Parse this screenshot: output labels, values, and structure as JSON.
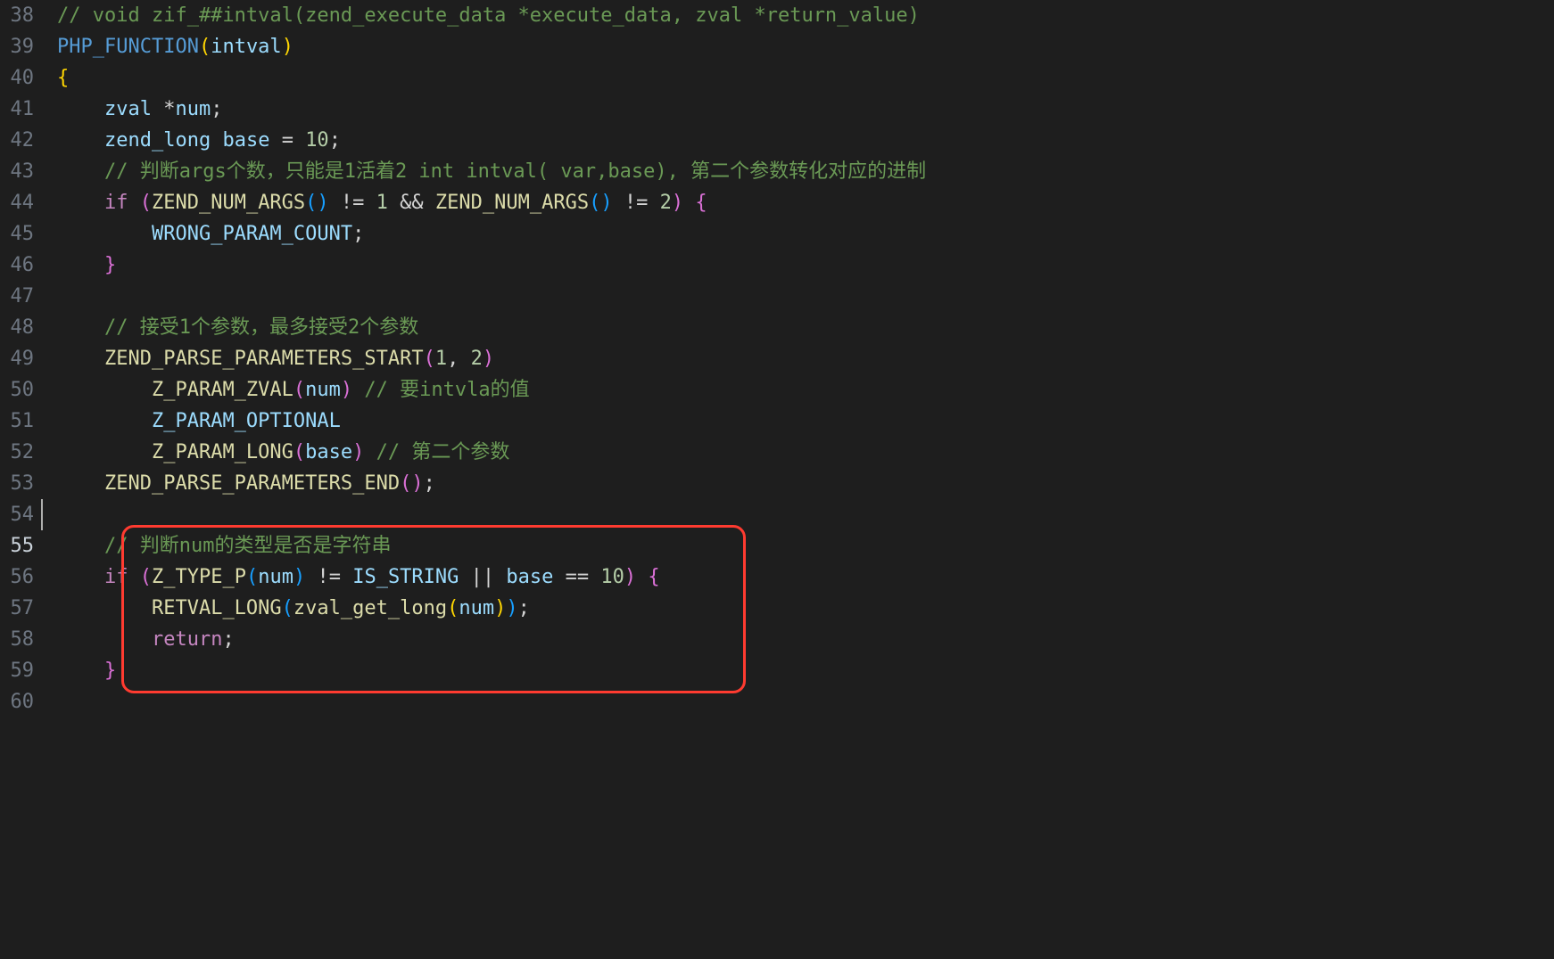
{
  "editor": {
    "startLine": 38,
    "activeLine": 55,
    "lines": [
      {
        "n": 38,
        "segments": [
          {
            "cls": "tok-comment",
            "t": "// void zif_##intval(zend_execute_data *execute_data, zval *return_value)"
          }
        ]
      },
      {
        "n": 39,
        "segments": [
          {
            "cls": "tok-fn",
            "t": "PHP_FUNCTION"
          },
          {
            "cls": "tok-brace-y",
            "t": "("
          },
          {
            "cls": "tok-ident",
            "t": "intval"
          },
          {
            "cls": "tok-brace-y",
            "t": ")"
          }
        ]
      },
      {
        "n": 40,
        "segments": [
          {
            "cls": "tok-brace-y",
            "t": "{"
          }
        ]
      },
      {
        "n": 41,
        "segments": [
          {
            "cls": "",
            "t": "    "
          },
          {
            "cls": "tok-ident",
            "t": "zval"
          },
          {
            "cls": "",
            "t": " "
          },
          {
            "cls": "tok-op",
            "t": "*"
          },
          {
            "cls": "tok-ident",
            "t": "num"
          },
          {
            "cls": "tok-op",
            "t": ";"
          }
        ]
      },
      {
        "n": 42,
        "segments": [
          {
            "cls": "",
            "t": "    "
          },
          {
            "cls": "tok-ident",
            "t": "zend_long"
          },
          {
            "cls": "",
            "t": " "
          },
          {
            "cls": "tok-ident",
            "t": "base"
          },
          {
            "cls": "",
            "t": " "
          },
          {
            "cls": "tok-op",
            "t": "="
          },
          {
            "cls": "",
            "t": " "
          },
          {
            "cls": "tok-number",
            "t": "10"
          },
          {
            "cls": "tok-op",
            "t": ";"
          }
        ]
      },
      {
        "n": 43,
        "segments": [
          {
            "cls": "",
            "t": "    "
          },
          {
            "cls": "tok-comment",
            "t": "// 判断args个数，只能是1活着2 int intval( var,base), 第二个参数转化对应的进制"
          }
        ]
      },
      {
        "n": 44,
        "segments": [
          {
            "cls": "",
            "t": "    "
          },
          {
            "cls": "tok-keyword",
            "t": "if"
          },
          {
            "cls": "",
            "t": " "
          },
          {
            "cls": "tok-brace-p",
            "t": "("
          },
          {
            "cls": "tok-call",
            "t": "ZEND_NUM_ARGS"
          },
          {
            "cls": "tok-brace-b",
            "t": "()"
          },
          {
            "cls": "",
            "t": " "
          },
          {
            "cls": "tok-op",
            "t": "!="
          },
          {
            "cls": "",
            "t": " "
          },
          {
            "cls": "tok-number",
            "t": "1"
          },
          {
            "cls": "",
            "t": " "
          },
          {
            "cls": "tok-op",
            "t": "&&"
          },
          {
            "cls": "",
            "t": " "
          },
          {
            "cls": "tok-call",
            "t": "ZEND_NUM_ARGS"
          },
          {
            "cls": "tok-brace-b",
            "t": "()"
          },
          {
            "cls": "",
            "t": " "
          },
          {
            "cls": "tok-op",
            "t": "!="
          },
          {
            "cls": "",
            "t": " "
          },
          {
            "cls": "tok-number",
            "t": "2"
          },
          {
            "cls": "tok-brace-p",
            "t": ")"
          },
          {
            "cls": "",
            "t": " "
          },
          {
            "cls": "tok-brace-p",
            "t": "{"
          }
        ]
      },
      {
        "n": 45,
        "segments": [
          {
            "cls": "",
            "t": "        "
          },
          {
            "cls": "tok-ident",
            "t": "WRONG_PARAM_COUNT"
          },
          {
            "cls": "tok-op",
            "t": ";"
          }
        ]
      },
      {
        "n": 46,
        "segments": [
          {
            "cls": "",
            "t": "    "
          },
          {
            "cls": "tok-brace-p",
            "t": "}"
          }
        ]
      },
      {
        "n": 47,
        "segments": []
      },
      {
        "n": 48,
        "segments": [
          {
            "cls": "",
            "t": "    "
          },
          {
            "cls": "tok-comment",
            "t": "// 接受1个参数，最多接受2个参数"
          }
        ]
      },
      {
        "n": 49,
        "segments": [
          {
            "cls": "",
            "t": "    "
          },
          {
            "cls": "tok-call",
            "t": "ZEND_PARSE_PARAMETERS_START"
          },
          {
            "cls": "tok-brace-p",
            "t": "("
          },
          {
            "cls": "tok-number",
            "t": "1"
          },
          {
            "cls": "tok-op",
            "t": ","
          },
          {
            "cls": "",
            "t": " "
          },
          {
            "cls": "tok-number",
            "t": "2"
          },
          {
            "cls": "tok-brace-p",
            "t": ")"
          }
        ]
      },
      {
        "n": 50,
        "segments": [
          {
            "cls": "",
            "t": "        "
          },
          {
            "cls": "tok-call",
            "t": "Z_PARAM_ZVAL"
          },
          {
            "cls": "tok-brace-p",
            "t": "("
          },
          {
            "cls": "tok-ident",
            "t": "num"
          },
          {
            "cls": "tok-brace-p",
            "t": ")"
          },
          {
            "cls": "",
            "t": " "
          },
          {
            "cls": "tok-comment",
            "t": "// 要intvla的值"
          }
        ]
      },
      {
        "n": 51,
        "segments": [
          {
            "cls": "",
            "t": "        "
          },
          {
            "cls": "tok-ident",
            "t": "Z_PARAM_OPTIONAL"
          }
        ]
      },
      {
        "n": 52,
        "segments": [
          {
            "cls": "",
            "t": "        "
          },
          {
            "cls": "tok-call",
            "t": "Z_PARAM_LONG"
          },
          {
            "cls": "tok-brace-p",
            "t": "("
          },
          {
            "cls": "tok-ident",
            "t": "base"
          },
          {
            "cls": "tok-brace-p",
            "t": ")"
          },
          {
            "cls": "",
            "t": " "
          },
          {
            "cls": "tok-comment",
            "t": "// 第二个参数"
          }
        ]
      },
      {
        "n": 53,
        "segments": [
          {
            "cls": "",
            "t": "    "
          },
          {
            "cls": "tok-call",
            "t": "ZEND_PARSE_PARAMETERS_END"
          },
          {
            "cls": "tok-brace-p",
            "t": "()"
          },
          {
            "cls": "tok-op",
            "t": ";"
          }
        ]
      },
      {
        "n": 54,
        "segments": []
      },
      {
        "n": 55,
        "segments": [
          {
            "cls": "",
            "t": "    "
          },
          {
            "cls": "tok-comment",
            "t": "// 判断num的类型是否是字符串"
          }
        ]
      },
      {
        "n": 56,
        "segments": [
          {
            "cls": "",
            "t": "    "
          },
          {
            "cls": "tok-keyword",
            "t": "if"
          },
          {
            "cls": "",
            "t": " "
          },
          {
            "cls": "tok-brace-p",
            "t": "("
          },
          {
            "cls": "tok-call",
            "t": "Z_TYPE_P"
          },
          {
            "cls": "tok-brace-b",
            "t": "("
          },
          {
            "cls": "tok-ident",
            "t": "num"
          },
          {
            "cls": "tok-brace-b",
            "t": ")"
          },
          {
            "cls": "",
            "t": " "
          },
          {
            "cls": "tok-op",
            "t": "!="
          },
          {
            "cls": "",
            "t": " "
          },
          {
            "cls": "tok-ident",
            "t": "IS_STRING"
          },
          {
            "cls": "",
            "t": " "
          },
          {
            "cls": "tok-op",
            "t": "||"
          },
          {
            "cls": "",
            "t": " "
          },
          {
            "cls": "tok-ident",
            "t": "base"
          },
          {
            "cls": "",
            "t": " "
          },
          {
            "cls": "tok-op",
            "t": "=="
          },
          {
            "cls": "",
            "t": " "
          },
          {
            "cls": "tok-number",
            "t": "10"
          },
          {
            "cls": "tok-brace-p",
            "t": ")"
          },
          {
            "cls": "",
            "t": " "
          },
          {
            "cls": "tok-brace-p",
            "t": "{"
          }
        ]
      },
      {
        "n": 57,
        "segments": [
          {
            "cls": "",
            "t": "        "
          },
          {
            "cls": "tok-call",
            "t": "RETVAL_LONG"
          },
          {
            "cls": "tok-brace-b",
            "t": "("
          },
          {
            "cls": "tok-call",
            "t": "zval_get_long"
          },
          {
            "cls": "tok-brace-y",
            "t": "("
          },
          {
            "cls": "tok-ident",
            "t": "num"
          },
          {
            "cls": "tok-brace-y",
            "t": ")"
          },
          {
            "cls": "tok-brace-b",
            "t": ")"
          },
          {
            "cls": "tok-op",
            "t": ";"
          }
        ]
      },
      {
        "n": 58,
        "segments": [
          {
            "cls": "",
            "t": "        "
          },
          {
            "cls": "tok-keyword",
            "t": "return"
          },
          {
            "cls": "tok-op",
            "t": ";"
          }
        ]
      },
      {
        "n": 59,
        "segments": [
          {
            "cls": "",
            "t": "    "
          },
          {
            "cls": "tok-brace-p",
            "t": "}"
          }
        ]
      },
      {
        "n": 60,
        "segments": []
      }
    ],
    "highlight": {
      "fromLine": 55,
      "toLine": 59,
      "leftPx": 108,
      "widthPx": 700
    }
  }
}
